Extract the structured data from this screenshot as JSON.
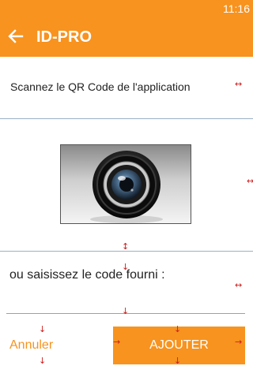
{
  "status_bar": {
    "time": "11:16"
  },
  "app_bar": {
    "title": "ID-PRO",
    "back_icon": "arrow-left-icon"
  },
  "scan": {
    "instruction": "Scannez le QR Code de l'application",
    "camera_icon": "camera-lens-icon"
  },
  "code_entry": {
    "label": "ou saisissez le code fourni :",
    "value": "",
    "placeholder": ""
  },
  "actions": {
    "cancel_label": "Annuler",
    "add_label": "AJOUTER"
  },
  "colors": {
    "accent": "#f7931e",
    "divider": "#9bb0c4",
    "debug_arrows": "#cc1f1f"
  }
}
